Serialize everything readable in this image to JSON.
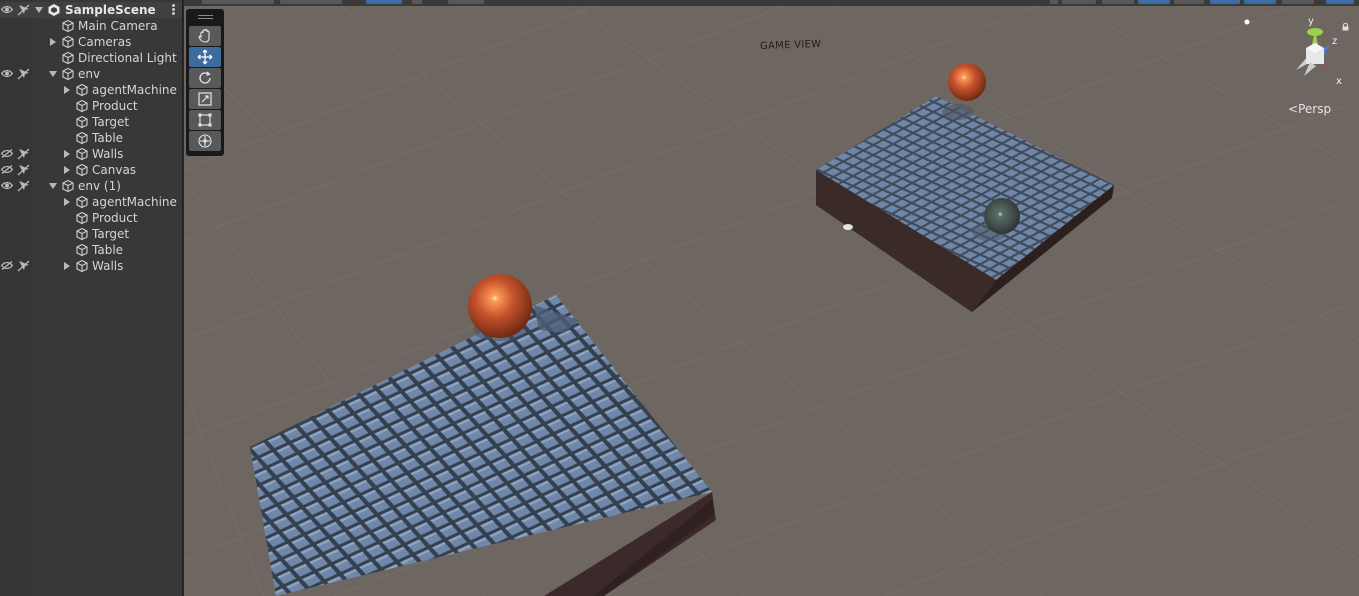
{
  "hierarchy": {
    "scene_name": "SampleScene",
    "items": [
      {
        "label": "Main Camera"
      },
      {
        "label": "Cameras"
      },
      {
        "label": "Directional Light"
      },
      {
        "label": "env"
      },
      {
        "label": "agentMachine"
      },
      {
        "label": "Product"
      },
      {
        "label": "Target"
      },
      {
        "label": "Table"
      },
      {
        "label": "Walls"
      },
      {
        "label": "Canvas"
      },
      {
        "label": "env (1)"
      },
      {
        "label": "agentMachine"
      },
      {
        "label": "Product"
      },
      {
        "label": "Target"
      },
      {
        "label": "Table"
      },
      {
        "label": "Walls"
      }
    ]
  },
  "scene": {
    "game_view_label": "GAME VIEW",
    "projection_label": "Persp",
    "gizmo": {
      "y": "y",
      "z": "z",
      "x": "x"
    },
    "tools": [
      "hand-tool",
      "move-tool",
      "rotate-tool",
      "scale-tool",
      "rect-tool",
      "transform-tool"
    ],
    "active_tool": "move-tool"
  },
  "colors": {
    "scene_bg": "#6e6660",
    "tile": "#6e86a8",
    "table_side": "#3b2a29",
    "sphere_orange": "#c4532d",
    "sphere_dark": "#3f4a48",
    "active_tool": "#3e6b9e"
  }
}
